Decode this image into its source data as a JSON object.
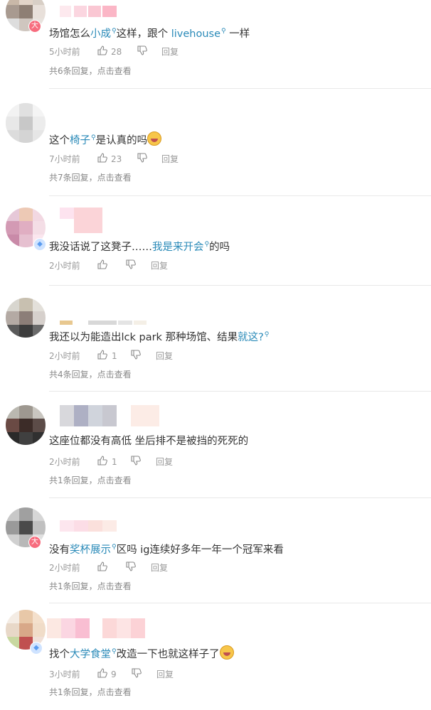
{
  "comments": [
    {
      "time": "5小时前",
      "likes": "28",
      "reply_label": "回复",
      "replies_text": "共6条回复，点击查看",
      "text_parts": [
        {
          "t": "场馆怎么"
        },
        {
          "t": "小成",
          "link": true
        },
        {
          "t": "这样，跟个 "
        },
        {
          "t": "livehouse",
          "link": true
        },
        {
          "t": " 一样"
        }
      ]
    },
    {
      "time": "7小时前",
      "likes": "23",
      "reply_label": "回复",
      "replies_text": "共7条回复，点击查看",
      "text_parts": [
        {
          "t": "这个"
        },
        {
          "t": "椅子",
          "link": true
        },
        {
          "t": "是认真的吗"
        }
      ]
    },
    {
      "time": "2小时前",
      "likes": "",
      "reply_label": "回复",
      "replies_text": "",
      "text_parts": [
        {
          "t": "我没话说了这凳子……"
        },
        {
          "t": "我是来开会",
          "link": true
        },
        {
          "t": "的吗"
        }
      ]
    },
    {
      "time": "2小时前",
      "likes": "1",
      "reply_label": "回复",
      "replies_text": "共4条回复，点击查看",
      "text_parts": [
        {
          "t": "我还以为能造出lck park 那种场馆、结果"
        },
        {
          "t": "就这?",
          "link": true
        },
        {
          "t": " "
        }
      ]
    },
    {
      "time": "2小时前",
      "likes": "1",
      "reply_label": "回复",
      "replies_text": "共1条回复，点击查看",
      "text_parts": [
        {
          "t": "这座位都没有高低 坐后排不是被挡的死死的"
        }
      ]
    },
    {
      "time": "2小时前",
      "likes": "",
      "reply_label": "回复",
      "replies_text": "共1条回复，点击查看",
      "text_parts": [
        {
          "t": "没有"
        },
        {
          "t": "奖杯展示",
          "link": true
        },
        {
          "t": "区吗 ig连续好多年一年一个冠军来看"
        }
      ]
    },
    {
      "time": "3小时前",
      "likes": "9",
      "reply_label": "回复",
      "replies_text": "共1条回复，点击查看",
      "text_parts": [
        {
          "t": "找个"
        },
        {
          "t": "大学食堂",
          "link": true
        },
        {
          "t": "改造一下也就这样子了"
        }
      ]
    }
  ],
  "badges": {
    "da": "大"
  }
}
